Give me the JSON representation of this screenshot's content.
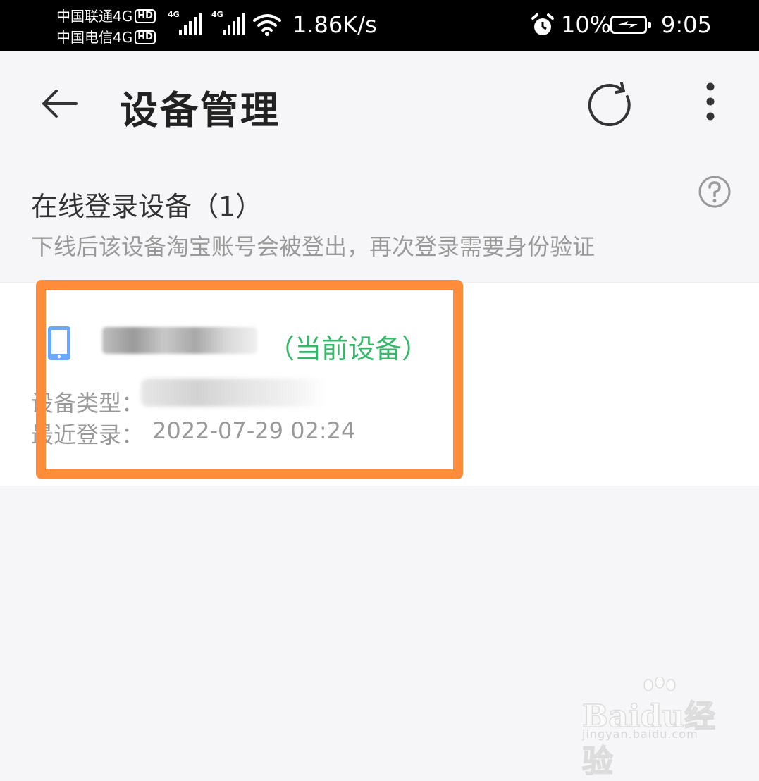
{
  "status_bar": {
    "carrier1": "中国联通4G",
    "carrier2": "中国电信4G",
    "hd_badge": "HD",
    "net_type": "4G",
    "net_speed": "1.86K/s",
    "battery_percent": "10%",
    "time": "9:05",
    "icons": [
      "signal-icon",
      "wifi-icon",
      "alarm-icon",
      "battery-charging-icon"
    ]
  },
  "header": {
    "title": "设备管理",
    "icons": [
      "back-arrow-icon",
      "refresh-icon",
      "more-icon"
    ]
  },
  "section": {
    "title": "在线登录设备（1）",
    "description": "下线后该设备淘宝账号会被登出，再次登录需要身份验证"
  },
  "device": {
    "current_tag": "（当前设备）",
    "type_label": "设备类型：",
    "login_label": "最近登录：",
    "login_time": "2022-07-29 02:24",
    "icon": "phone-icon"
  },
  "colors": {
    "accent_green": "#35b86a",
    "highlight_orange": "#ff8c3a",
    "phone_icon_blue": "#6aa8ff"
  },
  "watermark": {
    "brand": "Baidu经验",
    "url": "jingyan.baidu.com"
  }
}
